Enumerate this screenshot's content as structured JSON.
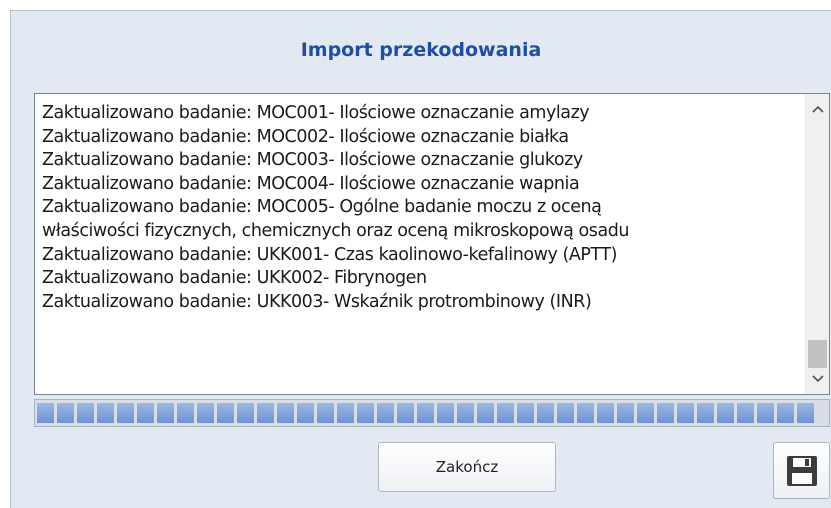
{
  "dialog": {
    "title": "Import przekodowania"
  },
  "log": {
    "lines": [
      "Zaktualizowano badanie: MOC001- Ilościowe oznaczanie amylazy",
      "Zaktualizowano badanie: MOC002- Ilościowe oznaczanie białka",
      "Zaktualizowano badanie: MOC003- Ilościowe oznaczanie glukozy",
      "Zaktualizowano badanie: MOC004- Ilościowe oznaczanie wapnia",
      "Zaktualizowano badanie: MOC005- Ogólne badanie moczu z oceną",
      "właściwości fizycznych, chemicznych oraz oceną mikroskopową osadu",
      "Zaktualizowano badanie: UKK001- Czas kaolinowo-kefalinowy (APTT)",
      "Zaktualizowano badanie: UKK002- Fibrynogen",
      "Zaktualizowano badanie: UKK003- Wskaźnik protrombinowy (INR)"
    ]
  },
  "progress": {
    "value": 1.0,
    "color": "#7b9ad8"
  },
  "buttons": {
    "finish_label": "Zakończ",
    "save_icon": "floppy-disk-icon"
  },
  "colors": {
    "title": "#1f4ea3",
    "dialog_bg": "#e3e9f3"
  }
}
